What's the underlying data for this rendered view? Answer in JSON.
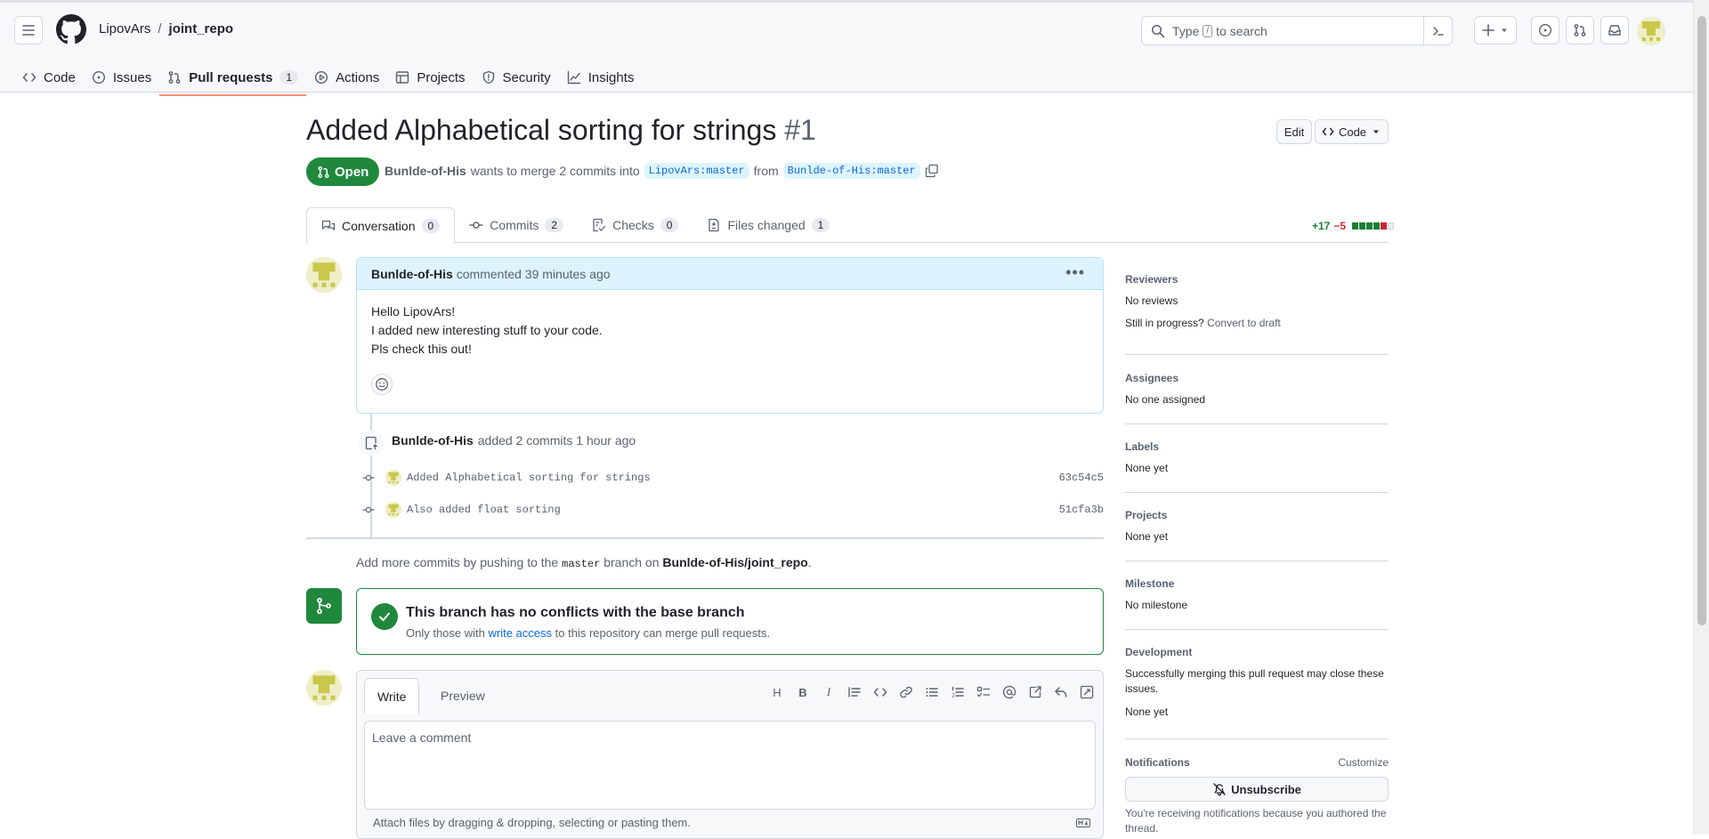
{
  "header": {
    "owner": "LipovArs",
    "separator": "/",
    "repo": "joint_repo",
    "search_prefix": "Type",
    "search_key": "/",
    "search_suffix": "to search"
  },
  "repo_nav": [
    {
      "label": "Code",
      "icon": "code-icon"
    },
    {
      "label": "Issues",
      "icon": "issue-opened-icon"
    },
    {
      "label": "Pull requests",
      "icon": "git-pull-request-icon",
      "count": "1",
      "selected": true
    },
    {
      "label": "Actions",
      "icon": "play-icon"
    },
    {
      "label": "Projects",
      "icon": "table-icon"
    },
    {
      "label": "Security",
      "icon": "shield-icon"
    },
    {
      "label": "Insights",
      "icon": "graph-icon"
    }
  ],
  "pr": {
    "title": "Added Alphabetical sorting for strings",
    "number": "#1",
    "edit_label": "Edit",
    "code_label": "Code",
    "state": "Open",
    "author": "Bunlde-of-His",
    "merge_text": "wants to merge 2 commits into",
    "base_branch": "LipovArs:master",
    "from_text": "from",
    "head_branch": "Bunlde-of-His:master"
  },
  "tabs": [
    {
      "label": "Conversation",
      "count": "0",
      "icon": "comment-discussion-icon"
    },
    {
      "label": "Commits",
      "count": "2",
      "icon": "git-commit-icon"
    },
    {
      "label": "Checks",
      "count": "0",
      "icon": "checklist-icon"
    },
    {
      "label": "Files changed",
      "count": "1",
      "icon": "file-diff-icon"
    }
  ],
  "diffstat": {
    "additions": "+17",
    "deletions": "−5",
    "green_color": "#1a7f37",
    "red_color": "#d1242f"
  },
  "comment": {
    "author": "Bunlde-of-His",
    "meta": "commented 39 minutes ago",
    "lines": [
      "Hello LipovArs!",
      "I added new interesting stuff to your code.",
      "Pls check this out!"
    ]
  },
  "commit_event": {
    "author": "Bunlde-of-His",
    "text": "added 2 commits 1 hour ago",
    "commits": [
      {
        "message": "Added Alphabetical sorting for strings",
        "sha": "63c54c5"
      },
      {
        "message": "Also added float sorting",
        "sha": "51cfa3b"
      }
    ]
  },
  "push_tip": {
    "prefix": "Add more commits by pushing to the",
    "branch": "master",
    "middle": "branch on",
    "repo": "Bunlde-of-His/joint_repo",
    "suffix": "."
  },
  "merge": {
    "title": "This branch has no conflicts with the base branch",
    "sub_prefix": "Only those with",
    "link": "write access",
    "sub_suffix": "to this repository can merge pull requests.",
    "color": "#1f883d"
  },
  "editor": {
    "write_tab": "Write",
    "preview_tab": "Preview",
    "placeholder": "Leave a comment",
    "attach": "Attach files by dragging & dropping, selecting or pasting them."
  },
  "sidebar": {
    "reviewers": {
      "heading": "Reviewers",
      "value": "No reviews",
      "note": "Still in progress?",
      "link": "Convert to draft"
    },
    "assignees": {
      "heading": "Assignees",
      "value": "No one assigned"
    },
    "labels": {
      "heading": "Labels",
      "value": "None yet"
    },
    "projects": {
      "heading": "Projects",
      "value": "None yet"
    },
    "milestone": {
      "heading": "Milestone",
      "value": "No milestone"
    },
    "development": {
      "heading": "Development",
      "desc": "Successfully merging this pull request may close these issues.",
      "value": "None yet"
    },
    "notifications": {
      "heading": "Notifications",
      "customize": "Customize",
      "button": "Unsubscribe",
      "note": "You're receiving notifications because you authored the thread."
    }
  }
}
